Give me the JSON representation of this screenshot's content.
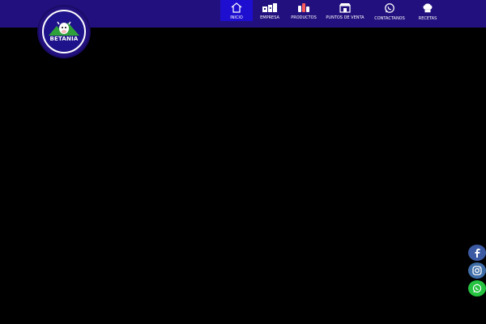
{
  "brand": {
    "name": "BETANIA"
  },
  "nav": {
    "items": [
      {
        "label": "INICIO",
        "icon": "home-icon",
        "active": true
      },
      {
        "label": "EMPRESA",
        "icon": "factory-icon",
        "active": false
      },
      {
        "label": "PRODUCTOS",
        "icon": "products-icon",
        "active": false
      },
      {
        "label": "PUNTOS DE VENTA",
        "icon": "store-icon",
        "active": false
      },
      {
        "label": "CONTACTANOS",
        "icon": "whatsapp-icon",
        "active": false
      },
      {
        "label": "RECETAS",
        "icon": "chef-hat-icon",
        "active": false
      }
    ]
  },
  "social": [
    {
      "name": "facebook",
      "icon": "facebook-icon",
      "color": "#3b5aa3"
    },
    {
      "name": "instagram",
      "icon": "instagram-icon",
      "color": "#3f6ea8"
    },
    {
      "name": "whatsapp",
      "icon": "whatsapp-icon",
      "color": "#25c240"
    }
  ],
  "colors": {
    "header": "#23107f",
    "active_nav": "#1e0fd0",
    "page_bg": "#000000"
  }
}
